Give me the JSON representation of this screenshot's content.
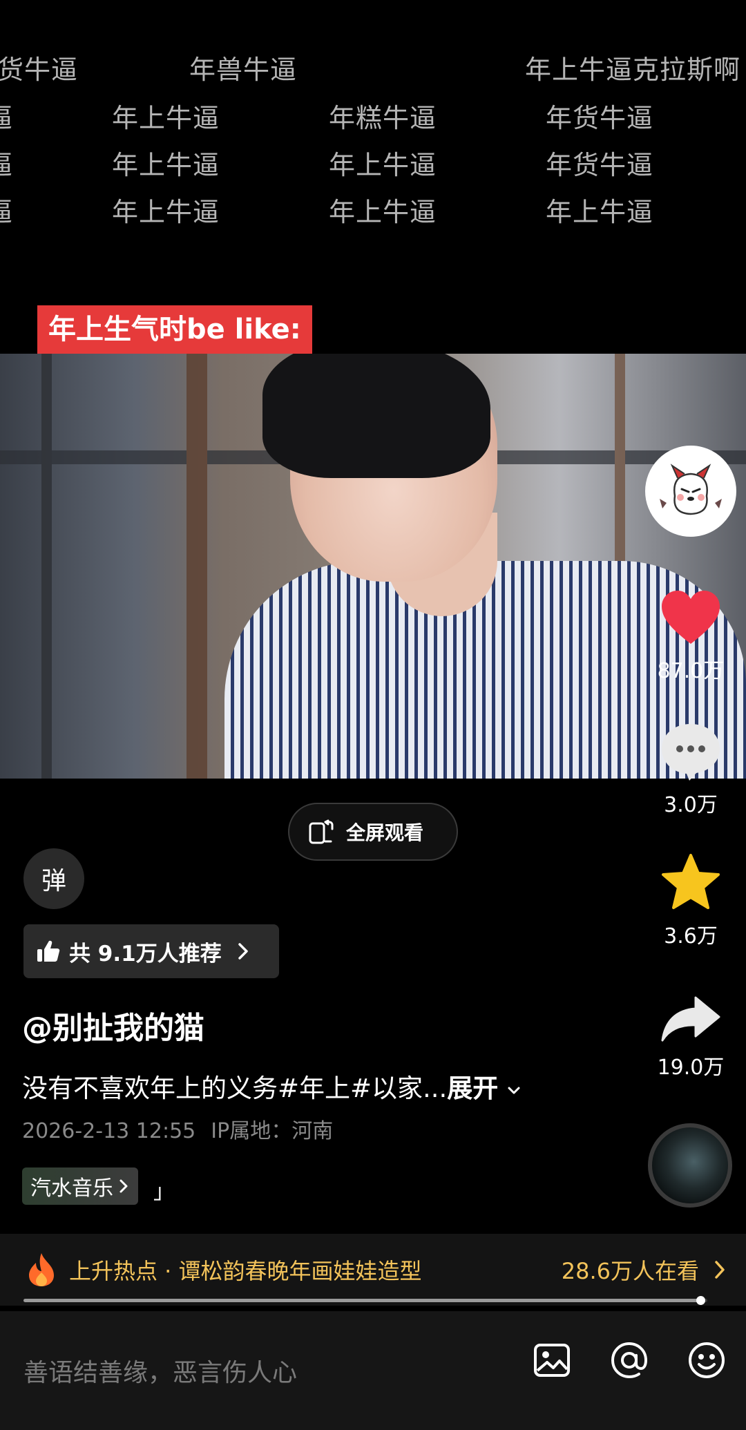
{
  "text_wall": {
    "row1": [
      "货牛逼",
      "年兽牛逼",
      "年上牛逼克拉斯啊"
    ],
    "row2": [
      "逼",
      "年上牛逼",
      "年糕牛逼",
      "年货牛逼"
    ],
    "row3": [
      "逼",
      "年上牛逼",
      "年上牛逼",
      "年货牛逼"
    ],
    "row4": [
      "逼",
      "年上牛逼",
      "年上牛逼",
      "年上牛逼"
    ]
  },
  "video": {
    "caption": "年上生气时be like:"
  },
  "fullscreen_button": {
    "label": "全屏观看",
    "icon": "fullscreen-icon"
  },
  "danmaku_button": {
    "label": "弹"
  },
  "recommend": {
    "label": "共 9.1万人推荐",
    "icon": "thumbs-up-icon"
  },
  "author": "@别扯我的猫",
  "description": {
    "text": "没有不喜欢年上的义务#年上#以家...",
    "expand_label": "展开"
  },
  "meta": {
    "datetime": "2026-2-13 12:55",
    "location": "IP属地：河南"
  },
  "music": {
    "label": "汽水音乐",
    "extra": "」"
  },
  "actions": {
    "likes": "87.0万",
    "comments": "3.0万",
    "favorites": "3.6万",
    "shares": "19.0万"
  },
  "hot_bar": {
    "title": "上升热点 · 谭松韵春晚年画娃娃造型",
    "viewers": "28.6万人在看",
    "icon": "flame-icon"
  },
  "progress": {
    "fraction": 0.99
  },
  "comment_input": {
    "placeholder": "善语结善缘，恶言伤人心",
    "icons": [
      "image-icon",
      "at-icon",
      "emoji-icon"
    ]
  },
  "colors": {
    "accent": "#f3c35a",
    "like": "#f0344a",
    "favorite": "#f7c51e",
    "caption_bg": "#e63a3a"
  }
}
